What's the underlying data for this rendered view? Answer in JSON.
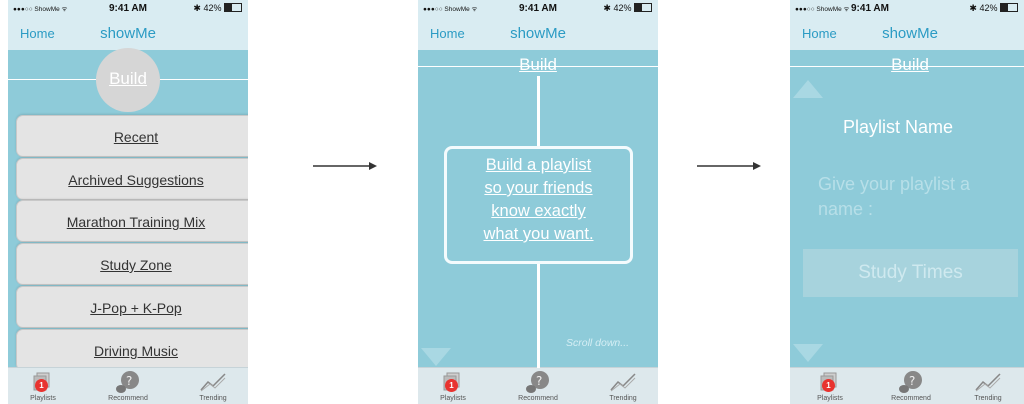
{
  "status_bar": {
    "carrier": "●●●○○ ShowMe ᯤ",
    "time": "9:41 AM",
    "battery": "✱ 42%"
  },
  "nav": {
    "home": "Home",
    "title": "showMe"
  },
  "tabs": [
    {
      "label": "Playlists",
      "icon": "playlists-icon",
      "badge": "1"
    },
    {
      "label": "Recommend",
      "icon": "recommend-icon"
    },
    {
      "label": "Trending",
      "icon": "trending-icon"
    }
  ],
  "screen1": {
    "build_label": "Build",
    "menu_items": [
      "Recent",
      "Archived Suggestions",
      "Marathon Training Mix",
      "Study Zone",
      "J-Pop + K-Pop",
      "Driving Music"
    ]
  },
  "screen2": {
    "build_label": "Build",
    "prompt_lines": [
      "Build a playlist",
      "so your friends",
      "know exactly",
      "what you want."
    ],
    "scroll_hint": "Scroll down..."
  },
  "screen3": {
    "build_label": "Build",
    "heading": "Playlist Name",
    "hint_lines": [
      "Give your playlist a",
      "name :"
    ],
    "name_value": "Study Times"
  },
  "colors": {
    "panel_bg": "#8ecbd9",
    "nav_bg": "#d9ecf2",
    "accent": "#2b9bc4",
    "badge": "#e8332f"
  }
}
